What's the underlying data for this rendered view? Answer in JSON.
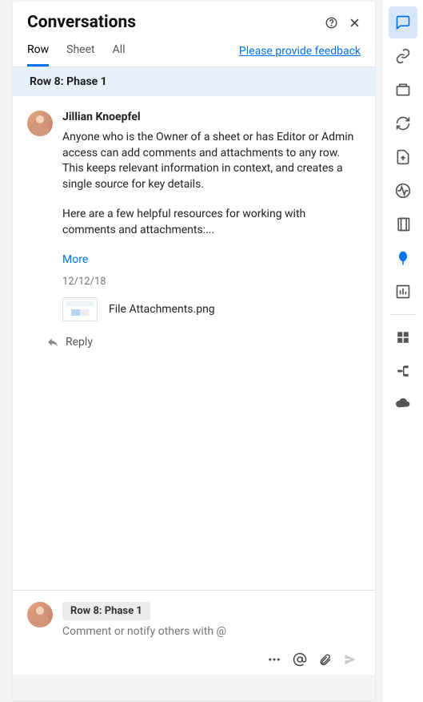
{
  "header": {
    "title": "Conversations"
  },
  "tabs": {
    "items": [
      {
        "label": "Row",
        "active": true
      },
      {
        "label": "Sheet",
        "active": false
      },
      {
        "label": "All",
        "active": false
      }
    ],
    "feedback": "Please provide feedback"
  },
  "context": {
    "label": "Row 8: Phase 1"
  },
  "comment": {
    "author": "Jillian Knoepfel",
    "para1": "Anyone who is the Owner of a sheet or has Editor or Admin access can add comments and attachments to any row. This keeps relevant information in context, and creates a single source for key details.",
    "para2": "Here are a few helpful resources for working with comments and attachments:...",
    "more": "More",
    "date": "12/12/18",
    "attachment_name": "File Attachments.png",
    "reply": "Reply"
  },
  "composer": {
    "chip": "Row 8: Phase 1",
    "placeholder": "Comment or notify others with @"
  },
  "rail": {
    "items": [
      {
        "name": "conversations-icon",
        "active": true
      },
      {
        "name": "attachments-icon"
      },
      {
        "name": "proofs-icon"
      },
      {
        "name": "update-requests-icon"
      },
      {
        "name": "publish-icon"
      },
      {
        "name": "activity-log-icon"
      },
      {
        "name": "summary-icon"
      },
      {
        "name": "brandfolder-icon",
        "highlight": true
      },
      {
        "name": "work-insights-icon"
      }
    ],
    "lower": [
      {
        "name": "grid-icon"
      },
      {
        "name": "connector-icon"
      },
      {
        "name": "cloud-icon"
      }
    ]
  }
}
